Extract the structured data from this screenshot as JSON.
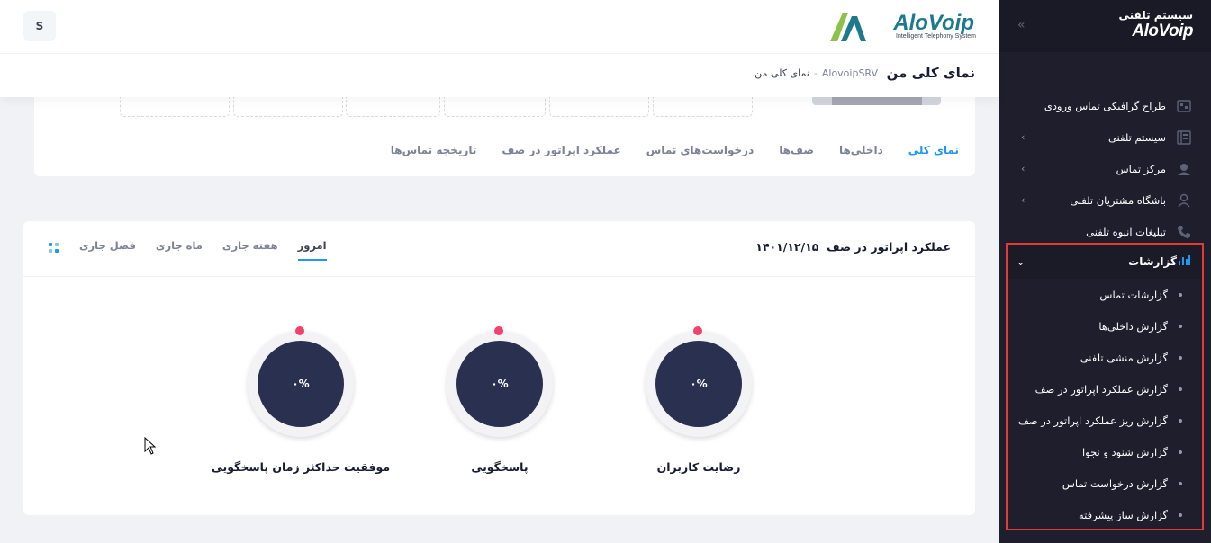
{
  "app": {
    "logo_brand": "AloVoip",
    "logo_subtitle": "Intelligent Telephony System",
    "sidebar_logo_fa": "سیستم تلفنی",
    "accent_color": "#2196f3",
    "sidebar_bg": "#1e1e2d",
    "highlight_color": "#e53935"
  },
  "user": {
    "avatar_letter": "S"
  },
  "subheader": {
    "title": "نمای کلی من",
    "crumb_server": "AlovoipSRV",
    "crumb_sep": "-",
    "crumb_page": "نمای کلی من"
  },
  "sidebar": {
    "toggle_icon": "double-chevron-left-icon",
    "items": [
      {
        "label": "طراح گرافیکی تماس ورودی",
        "icon": "flow-designer-icon",
        "has_arrow": false
      },
      {
        "label": "سیستم تلفنی",
        "icon": "phone-system-icon",
        "has_arrow": true
      },
      {
        "label": "مرکز تماس",
        "icon": "agent-icon",
        "has_arrow": true
      },
      {
        "label": "باشگاه مشتریان تلفنی",
        "icon": "customer-club-icon",
        "has_arrow": true
      },
      {
        "label": "تبلیغات انبوه تلفنی",
        "icon": "phone-icon",
        "has_arrow": false
      }
    ],
    "reports": {
      "label": "گزارشات",
      "icon": "bar-chart-icon",
      "sub_items": [
        "گزارشات تماس",
        "گزارش داخلی‌ها",
        "گزارش منشی تلفنی",
        "گزارش عملکرد اپراتور در صف",
        "گزارش ریز عملکرد اپراتور در صف",
        "گزارش شنود و نجوا",
        "گزارش درخواست تماس",
        "گزارش ساز پیشرفته"
      ]
    }
  },
  "overview_tabs": [
    "نمای کلی",
    "داخلی‌ها",
    "صف‌ها",
    "درخواست‌های تماس",
    "عملکرد اپراتور در صف",
    "تاریخچه تماس‌ها"
  ],
  "panel": {
    "title": "عملکرد اپراتور در صف",
    "date": "۱۴۰۱/۱۲/۱۵",
    "tabs": [
      "امروز",
      "هفته جاری",
      "ماه جاری",
      "فصل جاری"
    ],
    "active_tab": "امروز",
    "gauges": [
      {
        "label": "رضایت کاربران",
        "value": "۰%"
      },
      {
        "label": "پاسخگویی",
        "value": "۰%"
      },
      {
        "label": "موفقیت حداکثر زمان پاسخگویی",
        "value": "۰%"
      }
    ]
  }
}
